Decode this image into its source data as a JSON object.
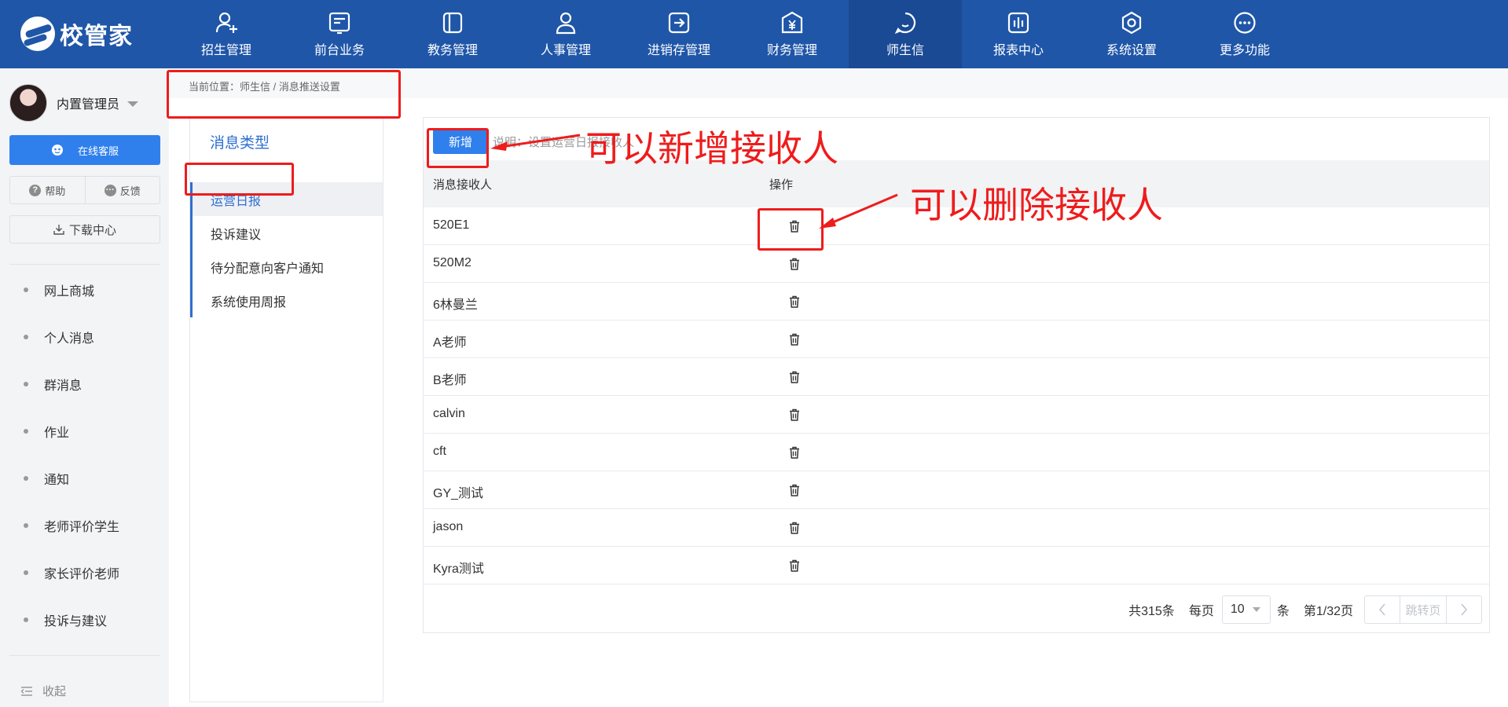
{
  "app": {
    "logo_text": "校管家"
  },
  "nav": {
    "items": [
      {
        "label": "招生管理",
        "icon": "user-plus-icon"
      },
      {
        "label": "前台业务",
        "icon": "screen-icon"
      },
      {
        "label": "教务管理",
        "icon": "book-icon"
      },
      {
        "label": "人事管理",
        "icon": "person-icon"
      },
      {
        "label": "进销存管理",
        "icon": "transfer-icon"
      },
      {
        "label": "财务管理",
        "icon": "yen-icon"
      },
      {
        "label": "师生信",
        "icon": "chat-icon"
      },
      {
        "label": "报表中心",
        "icon": "chart-icon"
      },
      {
        "label": "系统设置",
        "icon": "gear-icon"
      },
      {
        "label": "更多功能",
        "icon": "more-icon"
      }
    ],
    "active_index": 6
  },
  "sidebar": {
    "user_name": "内置管理员",
    "service_label": "在线客服",
    "help_label": "帮助",
    "feedback_label": "反馈",
    "download_label": "下载中心",
    "menu": [
      "网上商城",
      "个人消息",
      "群消息",
      "作业",
      "通知",
      "老师评价学生",
      "家长评价老师",
      "投诉与建议"
    ],
    "collapse_label": "收起"
  },
  "breadcrumb": {
    "text": "当前位置：师生信 / 消息推送设置"
  },
  "message_types": {
    "title": "消息类型",
    "items": [
      "运营日报",
      "投诉建议",
      "待分配意向客户通知",
      "系统使用周报"
    ],
    "active_index": 0
  },
  "toolbar": {
    "add_label": "新增",
    "note": "说明：设置运营日报接收人"
  },
  "table": {
    "columns": [
      "消息接收人",
      "操作"
    ],
    "rows": [
      "520E1",
      "520M2",
      "6林曼兰",
      "A老师",
      "B老师",
      "calvin",
      "cft",
      "GY_测试",
      "jason",
      "Kyra测试"
    ]
  },
  "pagination": {
    "total": "共315条",
    "per_page_label": "每页",
    "per_page": "10",
    "unit": "条",
    "page": "第1/32页",
    "jump_label": "跳转页"
  },
  "annotations": {
    "add_note": "可以新增接收人",
    "delete_note": "可以删除接收人",
    "color": "#ee1c1c"
  },
  "colors": {
    "topbar": "#1f56a8",
    "accent": "#2f80ed"
  }
}
